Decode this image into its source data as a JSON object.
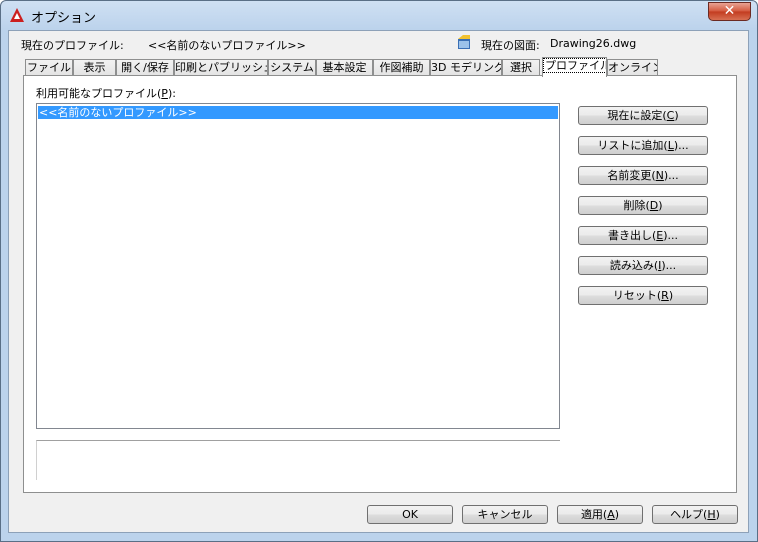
{
  "window": {
    "title": "オプション",
    "close_glyph": "✕"
  },
  "header": {
    "current_profile_label": "現在のプロファイル:",
    "current_profile_value": "<<名前のないプロファイル>>",
    "current_drawing_label": "現在の図面:",
    "current_drawing_value": "Drawing26.dwg"
  },
  "tabs": [
    {
      "label": "ファイル"
    },
    {
      "label": "表示"
    },
    {
      "label": "開く/保存"
    },
    {
      "label": "印刷とパブリッシュ"
    },
    {
      "label": "システム"
    },
    {
      "label": "基本設定"
    },
    {
      "label": "作図補助"
    },
    {
      "label": "3D モデリング"
    },
    {
      "label": "選択"
    },
    {
      "label": "プロファイル",
      "active": true
    },
    {
      "label": "オンライン"
    }
  ],
  "profiles": {
    "label": "利用可能なプロファイル(P):",
    "label_main": "利用可能なプロファイル(",
    "label_key": "P",
    "label_tail": "):",
    "items": [
      "<<名前のないプロファイル>>"
    ]
  },
  "side_buttons": [
    {
      "main": "現在に設定(",
      "key": "C",
      "tail": ")"
    },
    {
      "main": "リストに追加(",
      "key": "L",
      "tail": ")..."
    },
    {
      "main": "名前変更(",
      "key": "N",
      "tail": ")..."
    },
    {
      "main": "削除(",
      "key": "D",
      "tail": ")"
    },
    {
      "main": "書き出し(",
      "key": "E",
      "tail": ")..."
    },
    {
      "main": "読み込み(",
      "key": "I",
      "tail": ")..."
    },
    {
      "main": "リセット(",
      "key": "R",
      "tail": ")"
    }
  ],
  "footer": {
    "ok": "OK",
    "cancel": "キャンセル",
    "apply": {
      "main": "適用(",
      "key": "A",
      "tail": ")"
    },
    "help": {
      "main": "ヘルプ(",
      "key": "H",
      "tail": ")"
    }
  },
  "colors": {
    "selection": "#3399ff",
    "close_button": "#c74a2e",
    "app_icon": "#cc1f1f"
  },
  "icons": {
    "app": "autocad-logo-icon",
    "drawing": "drawing-file-icon",
    "close": "close-icon"
  }
}
